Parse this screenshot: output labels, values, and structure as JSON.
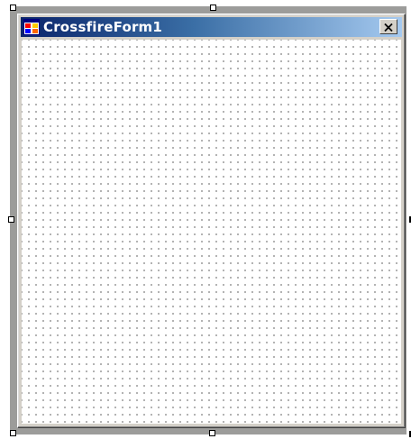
{
  "form": {
    "title": "CrossfireForm1",
    "icon": "form-app-icon",
    "close_icon": "close-icon"
  },
  "designer": {
    "grid": "dotted-grid",
    "selection": "selected"
  }
}
